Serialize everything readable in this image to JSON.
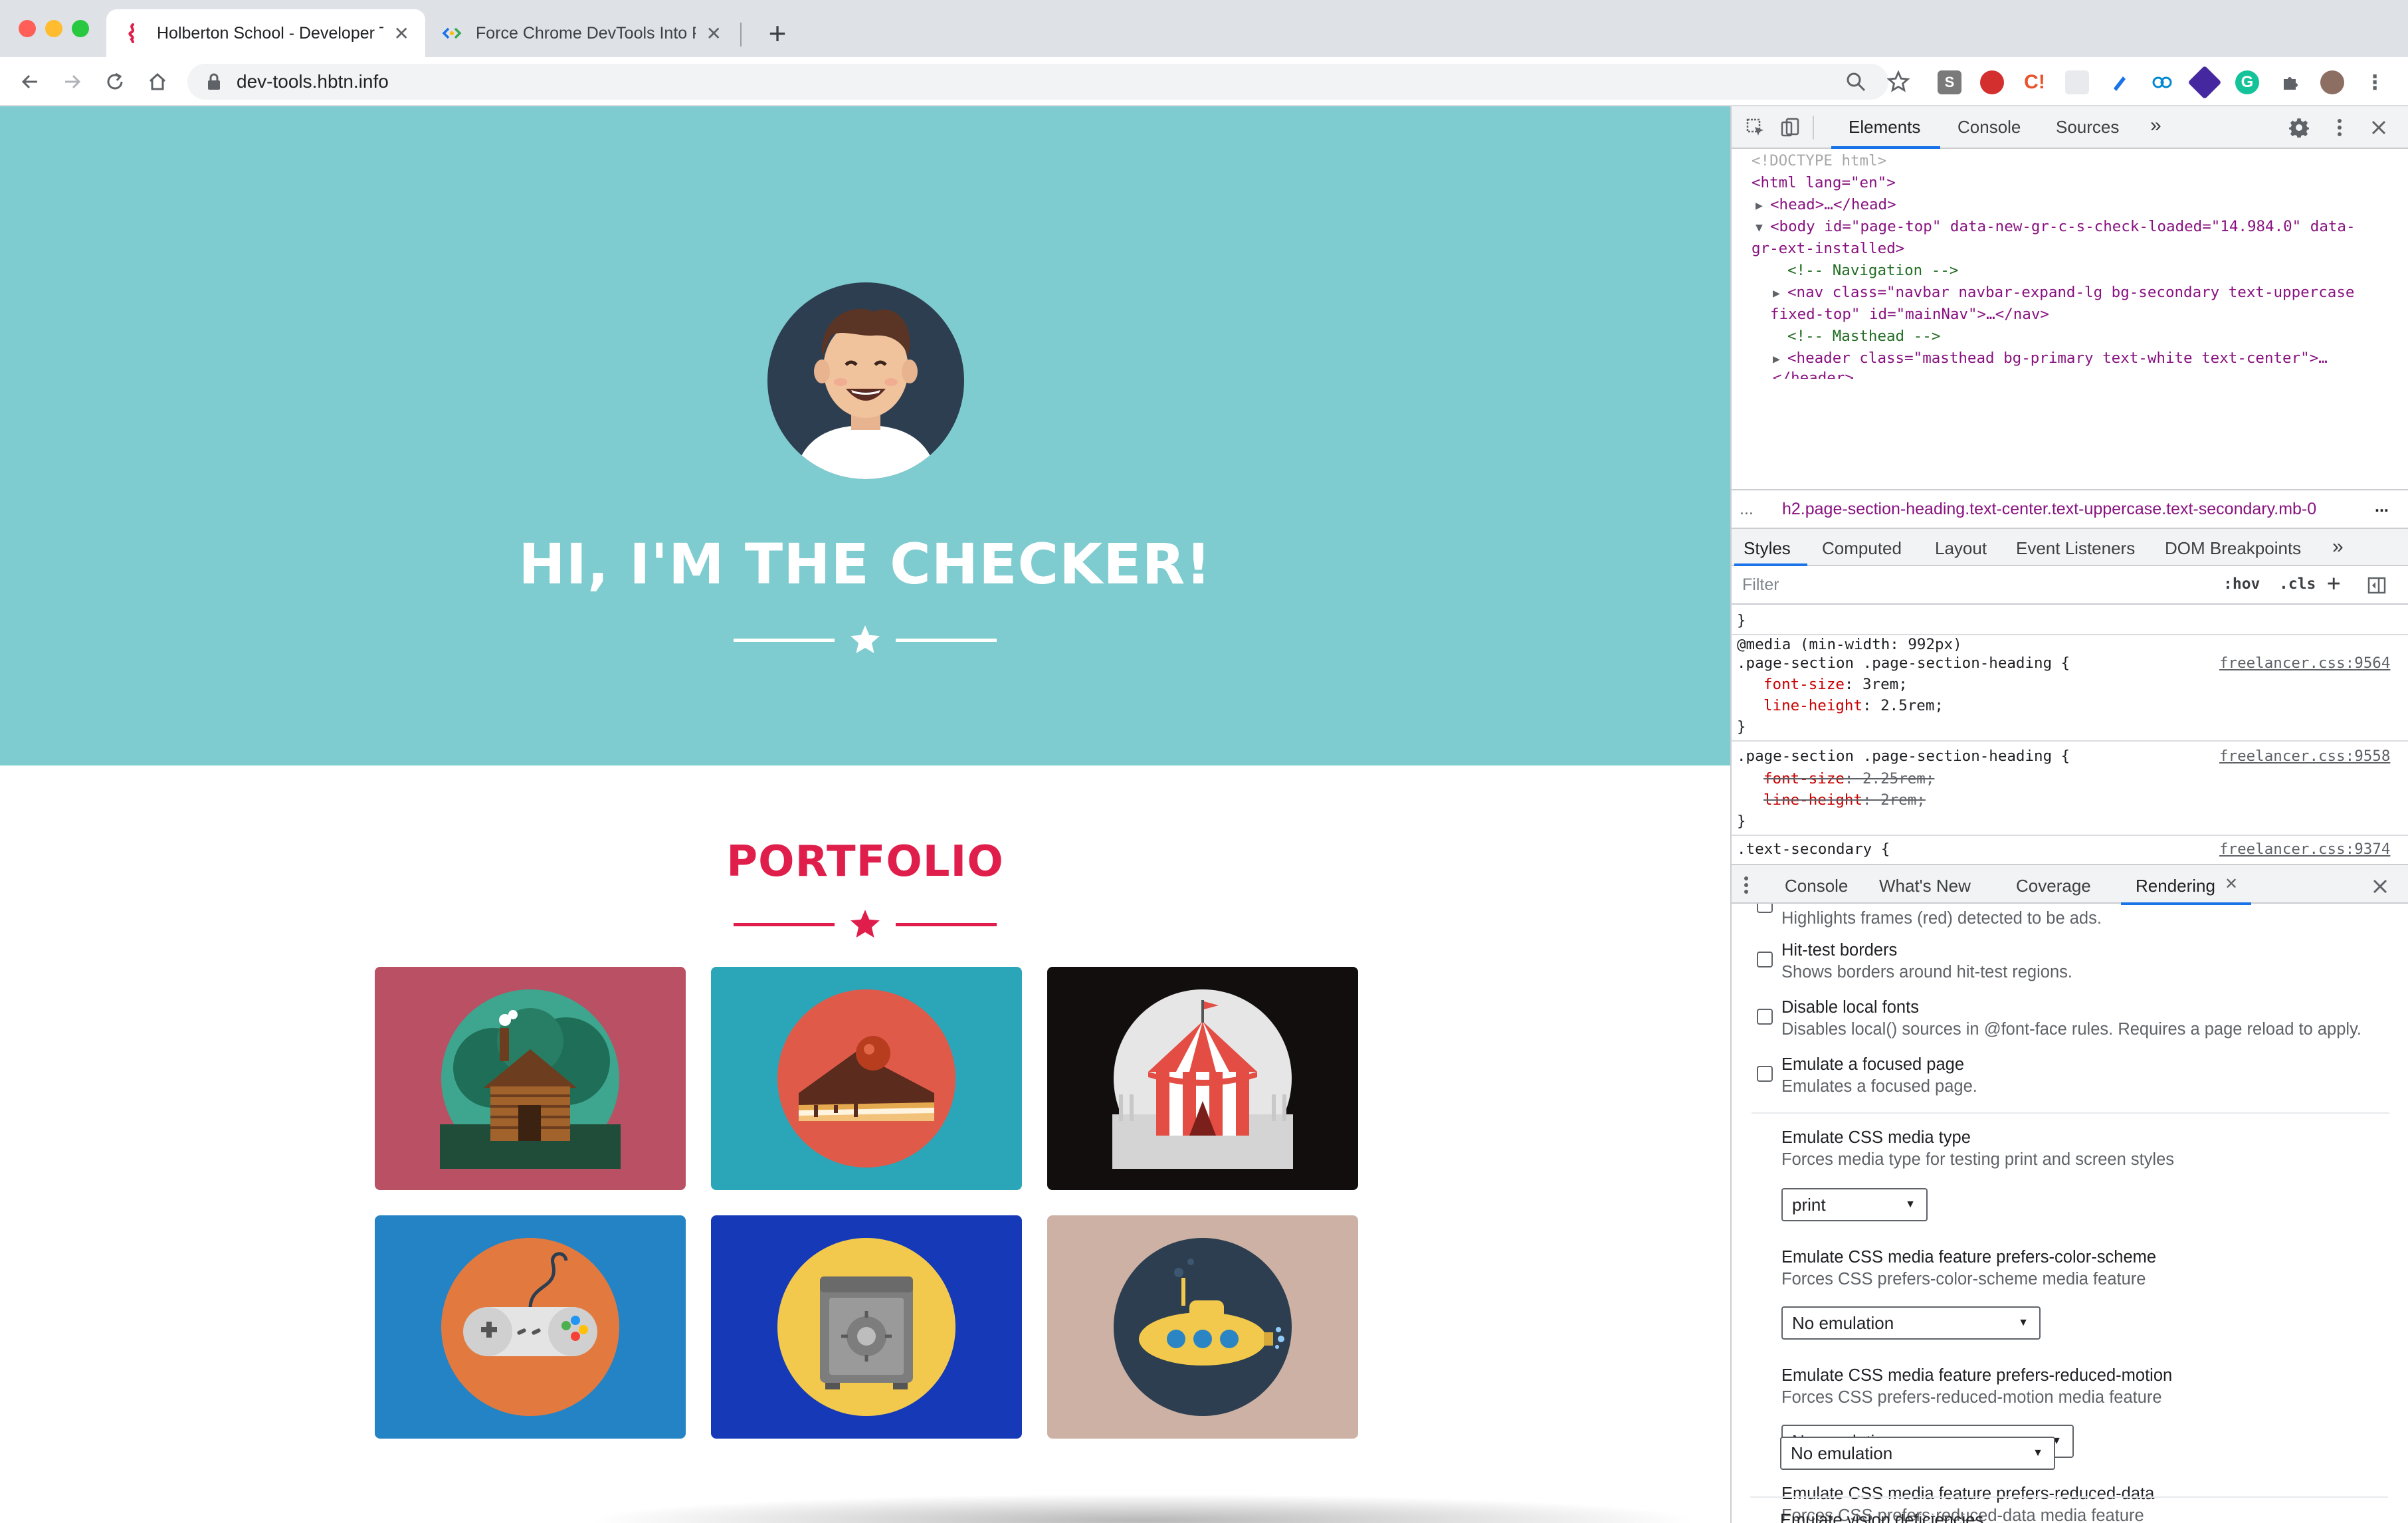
{
  "browser": {
    "tabs": [
      {
        "title": "Holberton School - Developer Tools",
        "active": true
      },
      {
        "title": "Force Chrome DevTools Into Prefers",
        "active": false
      }
    ],
    "new_tab": "+",
    "close_glyph": "✕",
    "url": "dev-tools.hbtn.info",
    "extensions": [
      "S",
      "C!"
    ]
  },
  "page": {
    "colors": {
      "masthead": "#7fccd0",
      "accent": "#e01e4b",
      "white": "#ffffff"
    },
    "hero_title": "HI, I'M THE CHECKER!",
    "portfolio_title": "PORTFOLIO",
    "portfolio_items": [
      {
        "icon": "cabin-icon",
        "bg": "#b95064"
      },
      {
        "icon": "cake-icon",
        "bg": "#2aa6b8"
      },
      {
        "icon": "circus-tent-icon",
        "bg": "#130e0e"
      },
      {
        "icon": "game-controller-icon",
        "bg": "#2383c4"
      },
      {
        "icon": "safe-icon",
        "bg": "#1639b8"
      },
      {
        "icon": "submarine-icon",
        "bg": "#ccb1a4"
      }
    ]
  },
  "devtools": {
    "main_tabs": [
      "Elements",
      "Console",
      "Sources",
      "»"
    ],
    "dom": {
      "doctype": "<!DOCTYPE html>",
      "html_open": "<html lang=\"en\">",
      "head": "<head>…</head>",
      "body_line1": "<body id=\"page-top\" data-new-gr-c-s-check-loaded=\"14.984.0\" data-",
      "body_line2": "gr-ext-installed>",
      "comment_nav": "<!-- Navigation -->",
      "nav_line1": "<nav class=\"navbar navbar-expand-lg bg-secondary text-uppercase",
      "nav_line2": "fixed-top\" id=\"mainNav\">…</nav>",
      "comment_masthead": "<!-- Masthead -->",
      "header_line1": "<header class=\"masthead bg-primary text-white text-center\">…",
      "header_line2": "</header>"
    },
    "breadcrumb_ellipsis": "...",
    "breadcrumb": "h2.page-section-heading.text-center.text-uppercase.text-secondary.mb-0",
    "breadcrumb_more": "...",
    "style_tabs": [
      "Styles",
      "Computed",
      "Layout",
      "Event Listeners",
      "DOM Breakpoints",
      "»"
    ],
    "filter_placeholder": "Filter",
    "filter_hov": ":hov",
    "filter_cls": ".cls",
    "filter_add": "+",
    "css": {
      "close_brace": "}",
      "media": "@media (min-width: 992px)",
      "rule1_selector": ".page-section .page-section-heading {",
      "rule1_source": "freelancer.css:9564",
      "rule1_prop1": "font-size",
      "rule1_val1": "3rem;",
      "rule1_prop2": "line-height",
      "rule1_val2": "2.5rem;",
      "rule2_selector": ".page-section .page-section-heading {",
      "rule2_source": "freelancer.css:9558",
      "rule2_prop1": "font-size",
      "rule2_val1": "2.25rem;",
      "rule2_prop2": "line-height",
      "rule2_val2": "2rem;",
      "rule3_selector": ".text-secondary {",
      "rule3_source": "freelancer.css:9374"
    },
    "drawer_tabs": [
      "Console",
      "What's New",
      "Coverage",
      "Rendering"
    ],
    "rendering": {
      "ads_desc": "Highlights frames (red) detected to be ads.",
      "options": [
        {
          "title": "Hit-test borders",
          "desc": "Shows borders around hit-test regions."
        },
        {
          "title": "Disable local fonts",
          "desc": "Disables local() sources in @font-face rules. Requires a page reload to apply."
        },
        {
          "title": "Emulate a focused page",
          "desc": "Emulates a focused page."
        }
      ],
      "media_type": {
        "title": "Emulate CSS media type",
        "desc": "Forces media type for testing print and screen styles",
        "value": "print"
      },
      "color_scheme": {
        "title": "Emulate CSS media feature prefers-color-scheme",
        "desc": "Forces CSS prefers-color-scheme media feature",
        "value": "No emulation"
      },
      "reduced_motion": {
        "title": "Emulate CSS media feature prefers-reduced-motion",
        "desc": "Forces CSS prefers-reduced-motion media feature",
        "value": "No emulation"
      },
      "reduced_data": {
        "title": "Emulate CSS media feature prefers-reduced-data",
        "desc": "Forces CSS prefers-reduced-data media feature",
        "value": "No emulation"
      },
      "vision": {
        "title": "Emulate vision deficiencies"
      }
    }
  }
}
